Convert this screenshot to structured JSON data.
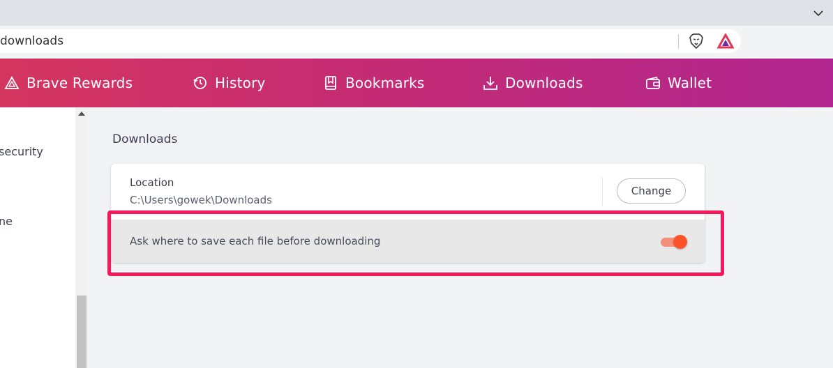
{
  "browser": {
    "url_text": "downloads"
  },
  "nav": {
    "items": [
      {
        "label": "Brave Rewards",
        "icon": "brave-rewards-icon"
      },
      {
        "label": "History",
        "icon": "history-icon"
      },
      {
        "label": "Bookmarks",
        "icon": "bookmarks-icon"
      },
      {
        "label": "Downloads",
        "icon": "downloads-icon"
      },
      {
        "label": "Wallet",
        "icon": "wallet-icon"
      }
    ]
  },
  "sidebar": {
    "items": [
      {
        "label": "security"
      },
      {
        "label": "ne"
      }
    ]
  },
  "downloads": {
    "title": "Downloads",
    "location_label": "Location",
    "location_path": "C:\\Users\\gowek\\Downloads",
    "change_label": "Change",
    "ask_label": "Ask where to save each file before downloading",
    "ask_enabled": true
  },
  "colors": {
    "nav_gradient_start": "#d4355f",
    "nav_gradient_end": "#b1268f",
    "toggle_on": "#fb542b",
    "highlight": "#f5185a"
  }
}
